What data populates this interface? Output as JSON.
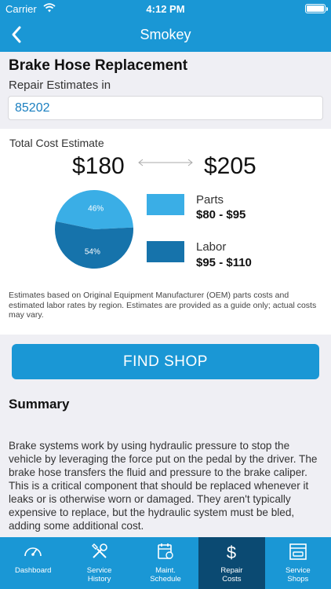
{
  "status_bar": {
    "carrier": "Carrier",
    "time": "4:12 PM"
  },
  "nav": {
    "title": "Smokey"
  },
  "job": {
    "title": "Brake Hose Replacement",
    "estimates_label": "Repair Estimates in",
    "zip": "85202"
  },
  "estimate": {
    "total_label": "Total Cost Estimate",
    "low": "$180",
    "high": "$205",
    "parts": {
      "label": "Parts",
      "range": "$80 - $95",
      "color": "#3aaee6"
    },
    "labor": {
      "label": "Labor",
      "range": "$95 - $110",
      "color": "#1673ab"
    },
    "disclaimer": "Estimates based on Original Equipment Manufacturer (OEM) parts costs and estimated labor rates by region. Estimates are provided as a guide only; actual costs may vary."
  },
  "chart_data": {
    "type": "pie",
    "slices": [
      {
        "name": "Parts",
        "value": 46,
        "label": "46%"
      },
      {
        "name": "Labor",
        "value": 54,
        "label": "54%"
      }
    ]
  },
  "actions": {
    "find_shop": "FIND SHOP"
  },
  "summary": {
    "title": "Summary",
    "body": "Brake systems work by using hydraulic pressure to stop the vehicle by leveraging the force put on the pedal by the driver. The brake hose transfers the fluid and pressure to the brake caliper. This is a critical component that should be replaced whenever it leaks or is otherwise worn or damaged. They aren't typically expensive to replace, but the hydraulic system must be bled, adding some additional cost."
  },
  "tabs": [
    {
      "label": "Dashboard",
      "icon": "gauge-icon",
      "active": false
    },
    {
      "label": "Service\nHistory",
      "icon": "wrench-screwdriver-icon",
      "active": false
    },
    {
      "label": "Maint.\nSchedule",
      "icon": "schedule-icon",
      "active": false
    },
    {
      "label": "Repair\nCosts",
      "icon": "dollar-icon",
      "active": true
    },
    {
      "label": "Service\nShops",
      "icon": "garage-icon",
      "active": false
    }
  ],
  "colors": {
    "brand": "#1a97d5",
    "active_tab": "#0b4a72"
  }
}
